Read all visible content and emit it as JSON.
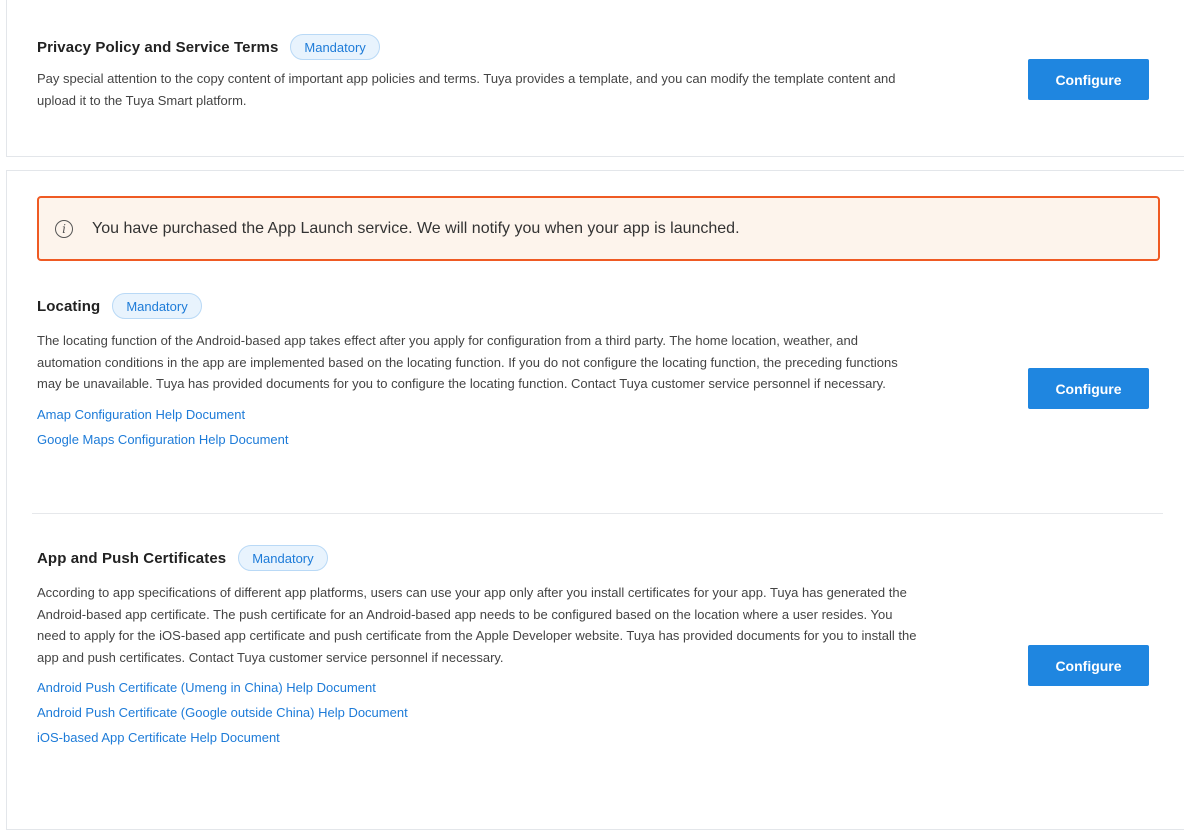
{
  "privacy": {
    "title": "Privacy Policy and Service Terms",
    "badge": "Mandatory",
    "description": "Pay special attention to the copy content of important app policies and terms. Tuya provides a template, and you can modify the template content and upload it to the Tuya Smart platform.",
    "button": "Configure"
  },
  "alert": {
    "icon": "info-icon",
    "text": "You have purchased the App Launch service. We will notify you when your app is launched."
  },
  "locating": {
    "title": "Locating",
    "badge": "Mandatory",
    "description": "The locating function of the Android-based app takes effect after you apply for configuration from a third party. The home location, weather, and automation conditions in the app are implemented based on the locating function. If you do not configure the locating function, the preceding functions may be unavailable. Tuya has provided documents for you to configure the locating function. Contact Tuya customer service personnel if necessary.",
    "links": [
      "Amap Configuration Help Document",
      "Google Maps Configuration Help Document"
    ],
    "button": "Configure"
  },
  "certificates": {
    "title": "App and Push Certificates",
    "badge": "Mandatory",
    "description": "According to app specifications of different app platforms, users can use your app only after you install certificates for your app. Tuya has generated the Android-based app certificate. The push certificate for an Android-based app needs to be configured based on the location where a user resides. You need to apply for the iOS-based app certificate and push certificate from the Apple Developer website. Tuya has provided documents for you to install the app and push certificates. Contact Tuya customer service personnel if necessary.",
    "links": [
      "Android Push Certificate (Umeng in China) Help Document",
      "Android Push Certificate (Google outside China) Help Document",
      "iOS-based App Certificate Help Document"
    ],
    "button": "Configure"
  },
  "colors": {
    "accent": "#1f86e0",
    "link": "#1d7bd8",
    "alert_border": "#ef5a23",
    "alert_bg": "#fdf4ec"
  }
}
